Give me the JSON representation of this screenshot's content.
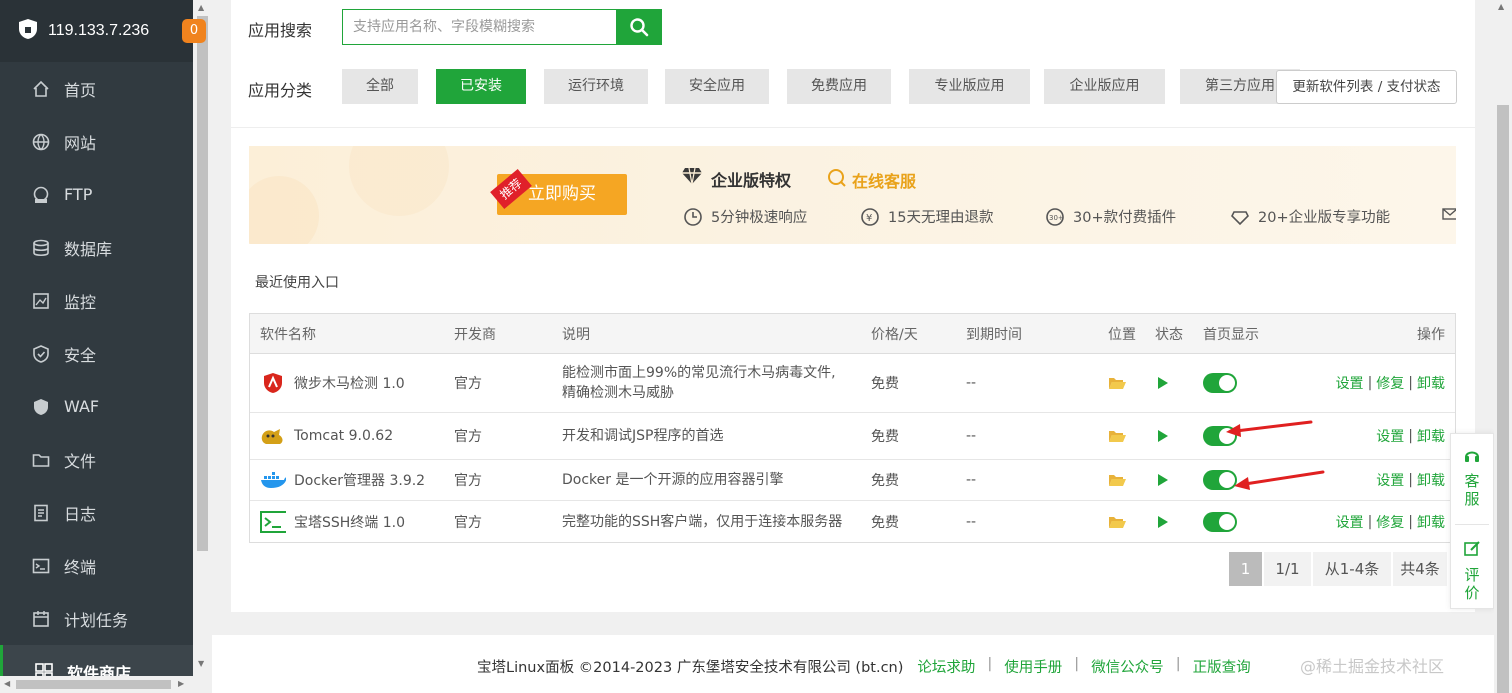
{
  "sidebar": {
    "host": "119.133.7.236",
    "badge": "0",
    "items": [
      {
        "label": "首页",
        "icon": "home-icon"
      },
      {
        "label": "网站",
        "icon": "globe-icon"
      },
      {
        "label": "FTP",
        "icon": "ftp-icon"
      },
      {
        "label": "数据库",
        "icon": "database-icon"
      },
      {
        "label": "监控",
        "icon": "monitor-icon"
      },
      {
        "label": "安全",
        "icon": "shield-icon"
      },
      {
        "label": "WAF",
        "icon": "waf-shield-icon"
      },
      {
        "label": "文件",
        "icon": "folder-icon"
      },
      {
        "label": "日志",
        "icon": "log-icon"
      },
      {
        "label": "终端",
        "icon": "terminal-icon"
      },
      {
        "label": "计划任务",
        "icon": "calendar-icon"
      },
      {
        "label": "软件商店",
        "icon": "store-icon"
      }
    ]
  },
  "search": {
    "label": "应用搜索",
    "placeholder": "支持应用名称、字段模糊搜索"
  },
  "categories": {
    "label": "应用分类",
    "items": [
      "全部",
      "已安装",
      "运行环境",
      "安全应用",
      "免费应用",
      "专业版应用",
      "企业版应用",
      "第三方应用"
    ],
    "selected": "已安装",
    "refresh": "更新软件列表 / 支付状态"
  },
  "banner": {
    "tag": "推荐",
    "buy": "立即购买",
    "title": "企业版特权",
    "service": "在线客服",
    "features": [
      "5分钟极速响应",
      "15天无理由退款",
      "30+款付费插件",
      "20+企业版专享功能"
    ]
  },
  "recent_label": "最近使用入口",
  "table": {
    "headers": {
      "name": "软件名称",
      "dev": "开发商",
      "desc": "说明",
      "price": "价格/天",
      "expire": "到期时间",
      "location": "位置",
      "status": "状态",
      "home": "首页显示",
      "ops": "操作"
    },
    "rows": [
      {
        "name": "微步木马检测 1.0",
        "dev": "官方",
        "desc1": "能检测市面上99%的常见流行木马病毒文件,",
        "desc2": "精确检测木马威胁",
        "price": "免费",
        "expire": "--",
        "ops": [
          "设置",
          "修复",
          "卸载"
        ],
        "icon": "trojan-detect-icon"
      },
      {
        "name": "Tomcat 9.0.62",
        "dev": "官方",
        "desc1": "开发和调试JSP程序的首选",
        "desc2": "",
        "price": "免费",
        "expire": "--",
        "ops": [
          "设置",
          "卸载"
        ],
        "icon": "tomcat-icon"
      },
      {
        "name": "Docker管理器 3.9.2",
        "dev": "官方",
        "desc1": "Docker 是一个开源的应用容器引擎",
        "desc2": "",
        "price": "免费",
        "expire": "--",
        "ops": [
          "设置",
          "卸载"
        ],
        "icon": "docker-icon"
      },
      {
        "name": "宝塔SSH终端 1.0",
        "dev": "官方",
        "desc1": "完整功能的SSH客户端，仅用于连接本服务器",
        "desc2": "",
        "price": "免费",
        "expire": "--",
        "ops": [
          "设置",
          "修复",
          "卸载"
        ],
        "icon": "ssh-terminal-icon"
      }
    ]
  },
  "pager": {
    "current": "1",
    "pages": "1/1",
    "range": "从1-4条",
    "total": "共4条"
  },
  "footer": {
    "copyright": "宝塔Linux面板 ©2014-2023 广东堡塔安全技术有限公司 (bt.cn)",
    "links": [
      "论坛求助",
      "使用手册",
      "微信公众号",
      "正版查询"
    ]
  },
  "float": {
    "service": "客服",
    "review": "评价"
  },
  "watermark": "@稀土掘金技术社区",
  "colors": {
    "accent": "#20a53a",
    "sidebar": "#313a40",
    "badge": "#f0831e",
    "arrow": "#e02020"
  }
}
